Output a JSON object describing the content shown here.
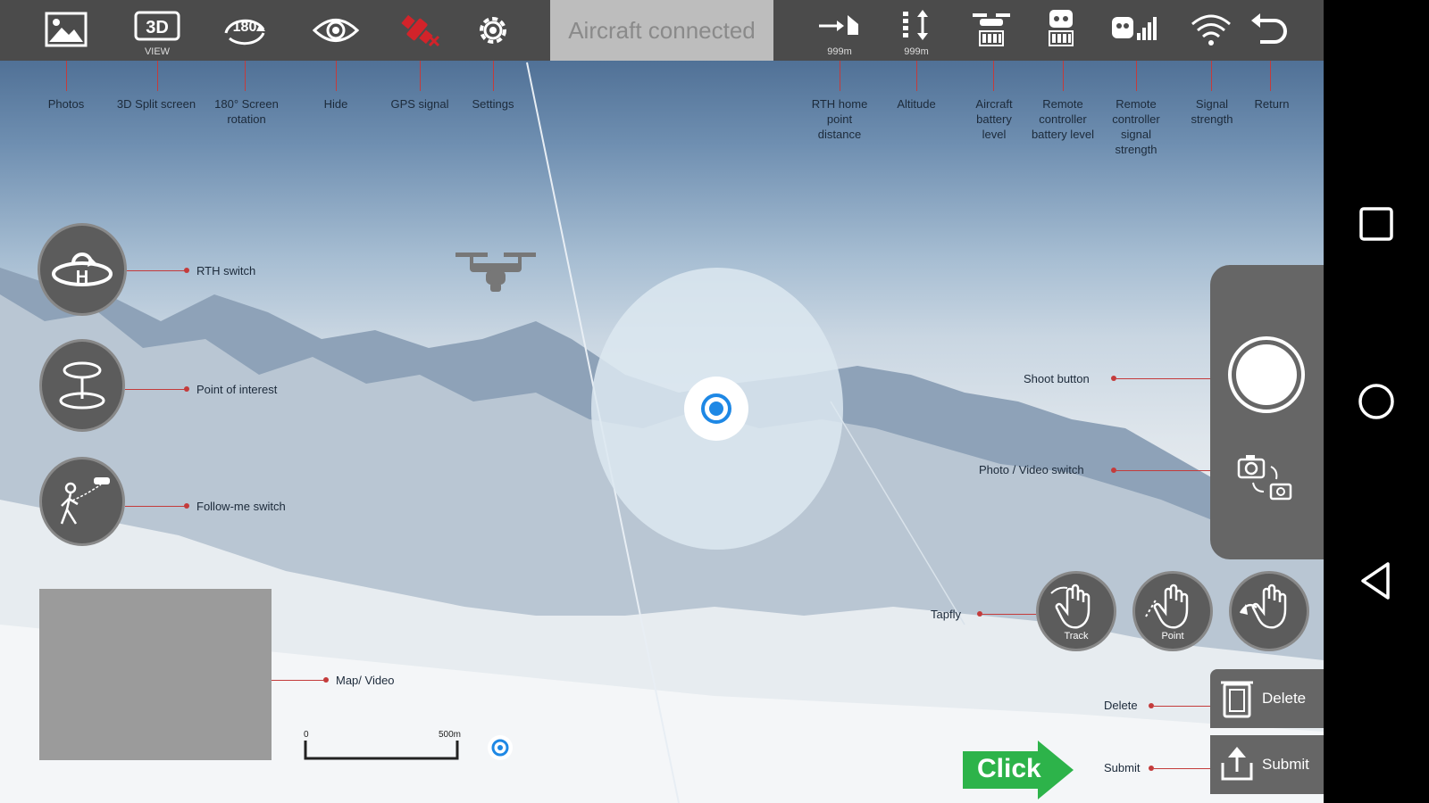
{
  "toolbar": {
    "threed_sub": "VIEW",
    "rotation_text": "180",
    "status": "Aircraft connected",
    "rth_distance_value": "999m",
    "altitude_value": "999m"
  },
  "callouts": {
    "photos": "Photos",
    "split": "3D Split screen",
    "rotation": "180° Screen rotation",
    "hide": "Hide",
    "gps": "GPS signal",
    "settings": "Settings",
    "rth_distance": "RTH home point distance",
    "altitude": "Altitude",
    "aircraft_battery": "Aircraft battery level",
    "rc_battery": "Remote controller battery level",
    "rc_signal": "Remote controller signal strength",
    "signal": "Signal strength",
    "return": "Return",
    "rth_switch": "RTH switch",
    "poi": "Point of interest",
    "follow": "Follow-me switch",
    "map_video": "Map/ Video",
    "shoot": "Shoot button",
    "photo_video": "Photo / Video switch",
    "tapfly": "Tapfly",
    "delete_callout": "Delete",
    "submit_callout": "Submit"
  },
  "gestures": {
    "track": "Track",
    "point": "Point"
  },
  "actions": {
    "delete": "Delete",
    "submit": "Submit",
    "click": "Click"
  },
  "scale": {
    "start": "0",
    "end": "500m"
  },
  "colors": {
    "toolbar": "#4b4b4b",
    "status_bg": "#bdbdbd",
    "callout_line": "#c43b3b",
    "gps_alert": "#d2232a",
    "joystick_dot": "#1e88e5",
    "click_green": "#2db34a"
  }
}
